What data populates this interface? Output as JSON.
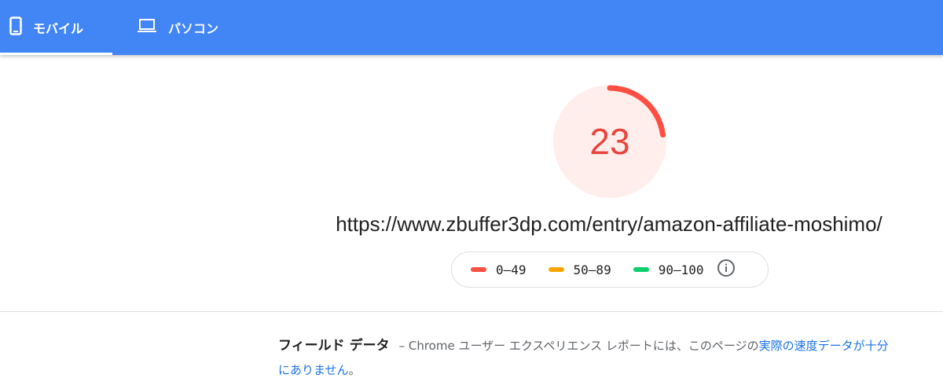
{
  "tabs": {
    "mobile": {
      "label": "モバイル",
      "icon": "smartphone-icon",
      "selected": true
    },
    "desktop": {
      "label": "パソコン",
      "icon": "laptop-icon",
      "selected": false
    }
  },
  "colors": {
    "header": "#4285f4",
    "fail": "#ff4e42",
    "average": "#ffa400",
    "pass": "#0cce6b",
    "link": "#1a73e8"
  },
  "score": {
    "value": "23",
    "fraction": 0.23
  },
  "url": "https://www.zbuffer3dp.com/entry/amazon-affiliate-moshimo/",
  "legend": {
    "items": [
      {
        "label": "0–49",
        "color": "#ff4e42"
      },
      {
        "label": "50–89",
        "color": "#ffa400"
      },
      {
        "label": "90–100",
        "color": "#0cce6b"
      }
    ],
    "info_icon": "info-icon"
  },
  "field_data": {
    "title": "フィールド データ",
    "description": "– Chrome ユーザー エクスペリエンス レポートには、このページの",
    "link_text": "実際の速度データが十分にありません",
    "suffix": "。"
  }
}
